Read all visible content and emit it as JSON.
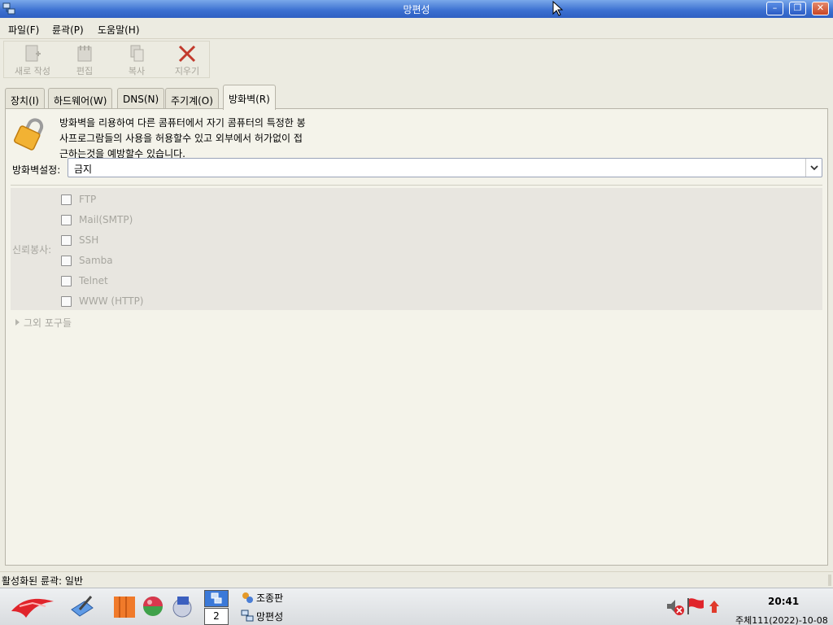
{
  "window": {
    "title": "망편성"
  },
  "menubar": [
    {
      "label": "파일(F)"
    },
    {
      "label": "륜곽(P)"
    },
    {
      "label": "도움말(H)"
    }
  ],
  "toolbar": {
    "new_label": "새로 작성",
    "edit_label": "편집",
    "copy_label": "복사",
    "delete_label": "지우기"
  },
  "tabs": [
    {
      "label": "장치(I)"
    },
    {
      "label": "하드웨어(W)"
    },
    {
      "label": "DNS(N)"
    },
    {
      "label": "주기계(O)"
    },
    {
      "label": "방화벽(R)"
    }
  ],
  "firewall": {
    "description": [
      "방화벽을 리용하여 다른 콤퓨터에서 자기 콤퓨터의 특정한 봉",
      "사프로그람들의 사용을 허용할수 있고 외부에서 허가없이 접",
      "근하는것을 예방할수 있습니다."
    ],
    "setting_label": "방화벽설정:",
    "setting_value": "금지",
    "trusted_label": "신뢰봉사:",
    "services": [
      {
        "label": "FTP",
        "checked": false
      },
      {
        "label": "Mail(SMTP)",
        "checked": false
      },
      {
        "label": "SSH",
        "checked": false
      },
      {
        "label": "Samba",
        "checked": false
      },
      {
        "label": "Telnet",
        "checked": false
      },
      {
        "label": "WWW (HTTP)",
        "checked": false
      }
    ],
    "other_ports_label": "그외 포구들"
  },
  "statusbar": {
    "text": "활성화된 륜곽: 일반"
  },
  "taskbar": {
    "workspace_1": "1",
    "workspace_2": "2",
    "tasks": [
      {
        "label": "조종판"
      },
      {
        "label": "망편성"
      }
    ],
    "clock": "20:41",
    "date": "주체111(2022)-10-08"
  }
}
